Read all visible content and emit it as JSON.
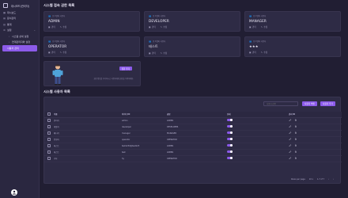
{
  "app": {
    "title": "대시보드(관리자)"
  },
  "sidebar": {
    "items": [
      {
        "label": "대시보드",
        "icon": "dashboard-icon"
      },
      {
        "label": "문서관리",
        "icon": "document-icon"
      },
      {
        "label": "통계",
        "icon": "chart-icon"
      },
      {
        "label": "설정",
        "icon": "gear-icon"
      }
    ],
    "sub_items": [
      {
        "label": "시스템 상세 설정",
        "icon": "settings-icon"
      },
      {
        "label": "연계관리자와 설정",
        "icon": "link-icon"
      }
    ],
    "active_item": {
      "label": "사용자 관리"
    }
  },
  "roles_section": {
    "title": "시스템 접속 권한 목록",
    "cards": [
      {
        "small": "총 1명의 사용자",
        "name": "ADMIN",
        "stat1": "관리",
        "stat2": "수정"
      },
      {
        "small": "총 1명의 사용자",
        "name": "DEVELOPER",
        "stat1": "관리",
        "stat2": "수정"
      },
      {
        "small": "총 1명의 사용자",
        "name": "MANAGER",
        "stat1": "관리",
        "stat2": "수정"
      },
      {
        "small": "총 1명의 사용자",
        "name": "OPERATOR",
        "stat1": "관리",
        "stat2": "수정"
      },
      {
        "small": "총 1명의 사용자",
        "name": "테스트",
        "stat1": "관리",
        "stat2": "수정"
      },
      {
        "small": "총 1명의 사용자",
        "name": "★★★",
        "stat1": "관리",
        "stat2": "수정"
      }
    ],
    "promo": {
      "button": "권한 추가",
      "text": "권한 정보를 추가하시고 사용자에게 권한을 부여하세요."
    }
  },
  "users_section": {
    "title": "시스템 사용자 목록",
    "search_placeholder": "사용자 검색",
    "btn_export": "사용자 엑셀",
    "btn_add": "사용자 추가",
    "columns": {
      "name": "이름",
      "id": "아이디 ID",
      "role": "권한",
      "active": "상태",
      "actions": "관리 ID"
    },
    "rows": [
      {
        "name": "관리자",
        "id": "admin",
        "role": "ADMIN"
      },
      {
        "name": "개발자",
        "id": "developer",
        "role": "DEVELOPER"
      },
      {
        "name": "매니저",
        "id": "manager",
        "role": "MANAGER"
      },
      {
        "name": "운영자",
        "id": "operator",
        "role": "OPERATOR"
      },
      {
        "name": "테스트",
        "id": "test1234@test123",
        "role": "ADMIN"
      },
      {
        "name": "테스트",
        "id": "test",
        "role": "ADMIN"
      },
      {
        "name": "기타",
        "id": "hy",
        "role": "OPERATOR"
      }
    ],
    "footer": {
      "rows_per_page_label": "Rows per page",
      "rows_per_page_value": "10",
      "range": "1-7 of 7"
    }
  },
  "colors": {
    "accent": "#8c5bea",
    "background": "#211e33",
    "card": "#2e2b45"
  }
}
